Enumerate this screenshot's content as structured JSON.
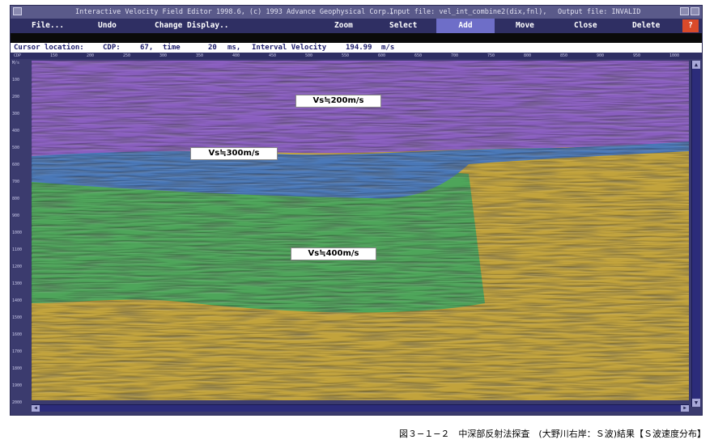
{
  "window": {
    "title": "Interactive Velocity Field Editor 1998.6,  (c) 1993 Advance Geophysical Corp.,",
    "input_file": "Input file: vel_int_combine2(dix,fnl),",
    "output_file": "Output file: INVALID"
  },
  "menu": {
    "file": "File...",
    "undo": "Undo",
    "change_display": "Change Display..",
    "zoom": "Zoom",
    "select": "Select",
    "add": "Add",
    "move": "Move",
    "close": "Close",
    "delete": "Delete",
    "help": "?"
  },
  "status": {
    "cursor_label": "Cursor location:",
    "cdp_label": "CDP:",
    "cdp_value": "67,",
    "time_label": "time",
    "time_value": "20",
    "time_unit": "ms,",
    "velocity_label": "Interval Velocity",
    "velocity_value": "194.99",
    "velocity_unit": "m/s"
  },
  "ruler": [
    "CDP",
    "150",
    "200",
    "250",
    "300",
    "350",
    "400",
    "450",
    "500",
    "550",
    "600",
    "650",
    "700",
    "750",
    "800",
    "850",
    "900",
    "950",
    "1000"
  ],
  "yaxis": [
    "M/s",
    "100",
    "200",
    "300",
    "400",
    "500",
    "600",
    "700",
    "800",
    "900",
    "1000",
    "1100",
    "1200",
    "1300",
    "1400",
    "1500",
    "1600",
    "1700",
    "1800",
    "1900",
    "2000"
  ],
  "labels": {
    "vs200": "Vs≒200m/s",
    "vs300": "Vs≒300m/s",
    "vs400": "Vs≒400m/s"
  },
  "caption": "図３−１−２　中深部反射法探査　(大野川右岸：Ｓ波)結果【Ｓ波速度分布】",
  "colors": {
    "vs200_layer": "#8a5fc0",
    "vs300_layer": "#4a78b8",
    "vs400_layer": "#4ea55a",
    "deep_layer": "#c2a33c"
  }
}
